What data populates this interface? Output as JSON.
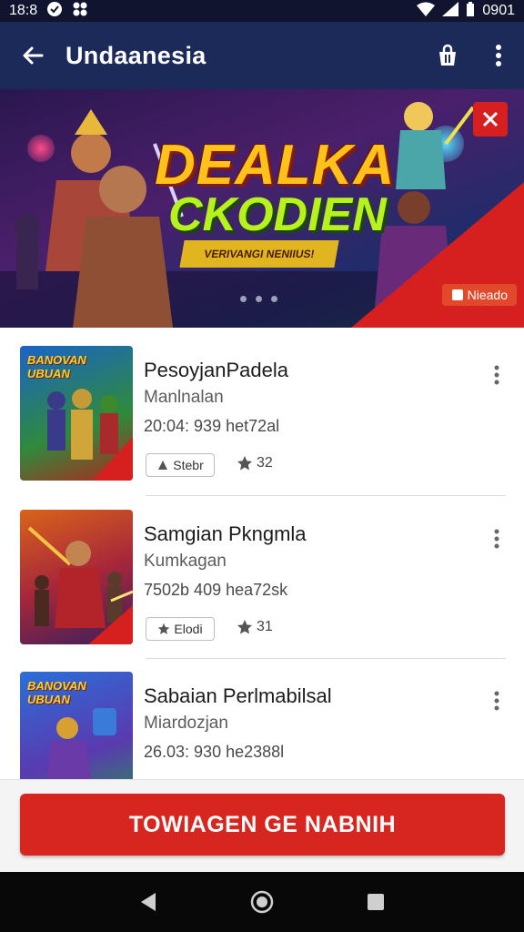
{
  "status": {
    "time": "18:8",
    "clock_right": "0901"
  },
  "appbar": {
    "title": "Undaanesia"
  },
  "banner": {
    "headline_1": "DEALKA",
    "headline_2": "CKODIEN",
    "subline": "VERIVANGI NENIIUS!",
    "tag": "Nieado",
    "dots": 3,
    "colors": {
      "background": "#2a174f",
      "accent_red": "#d6201f",
      "headline_yellow": "#ffc21a",
      "headline_green": "#b8f21d"
    }
  },
  "items": [
    {
      "name": "PesoyjanPadela",
      "developer": "Manlnalan",
      "meta": "20:04: 939 het72al",
      "chip_label": "Stebr",
      "rating": "32",
      "thumb_title": "BANOVAN UBUAN"
    },
    {
      "name": "Samgian Pkngmla",
      "developer": "Kumkagan",
      "meta": "7502b 409 hea72sk",
      "chip_label": "Elodi",
      "rating": "31",
      "thumb_title": ""
    },
    {
      "name": "Sabaian Perlmabilsal",
      "developer": "Miardozjan",
      "meta": "26.03: 930 he2388l",
      "chip_label": "",
      "rating": "",
      "thumb_title": "BANOVAN UBUAN"
    }
  ],
  "cta": {
    "label": "TOWIAGEN GE NABNIH"
  },
  "navbar": {
    "back_icon": "back-triangle-icon",
    "home_icon": "home-circle-icon",
    "recents_icon": "recents-square-icon"
  }
}
